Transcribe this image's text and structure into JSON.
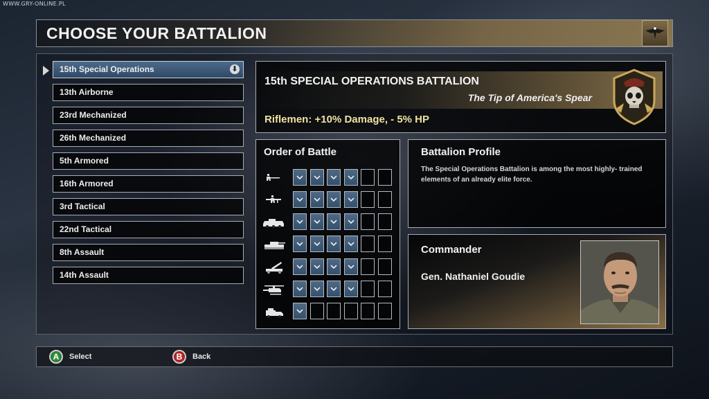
{
  "watermark": "WWW.GRY-ONLINE.PL",
  "header": {
    "title": "CHOOSE YOUR BATTALION"
  },
  "battalions": [
    {
      "label": "15th Special Operations"
    },
    {
      "label": "13th Airborne"
    },
    {
      "label": "23rd Mechanized"
    },
    {
      "label": "26th Mechanized"
    },
    {
      "label": "5th Armored"
    },
    {
      "label": "16th Armored"
    },
    {
      "label": "3rd Tactical"
    },
    {
      "label": "22nd Tactical"
    },
    {
      "label": "8th Assault"
    },
    {
      "label": "14th Assault"
    }
  ],
  "selected_index": 0,
  "detail": {
    "name": "15th SPECIAL OPERATIONS BATTALION",
    "motto": "The Tip of America's Spear",
    "bonus": "Riflemen: +10% Damage, - 5% HP",
    "badge_icon": "skull-beret-badge-icon"
  },
  "order_of_battle": {
    "title": "Order of Battle",
    "slots_per_row": 6,
    "rows": [
      {
        "unit_icon": "rifleman-icon",
        "filled": 4
      },
      {
        "unit_icon": "machine-gunner-icon",
        "filled": 4
      },
      {
        "unit_icon": "apc-icon",
        "filled": 4
      },
      {
        "unit_icon": "tank-icon",
        "filled": 4
      },
      {
        "unit_icon": "artillery-icon",
        "filled": 4
      },
      {
        "unit_icon": "helicopter-icon",
        "filled": 4
      },
      {
        "unit_icon": "support-vehicle-icon",
        "filled": 1
      }
    ]
  },
  "profile": {
    "title": "Battalion Profile",
    "text": "The Special Operations Battalion is among the most highly- trained elements of an already elite force."
  },
  "commander": {
    "title": "Commander",
    "name": "Gen. Nathaniel Goudie"
  },
  "footer": {
    "select_glyph": "A",
    "select_label": "Select",
    "back_glyph": "B",
    "back_label": "Back"
  },
  "colors": {
    "selected_item": "#3f5b7b",
    "slot_filled": "#425e7b",
    "bonus_text": "#f0e2a0",
    "gold_accent": "#a8894f"
  }
}
